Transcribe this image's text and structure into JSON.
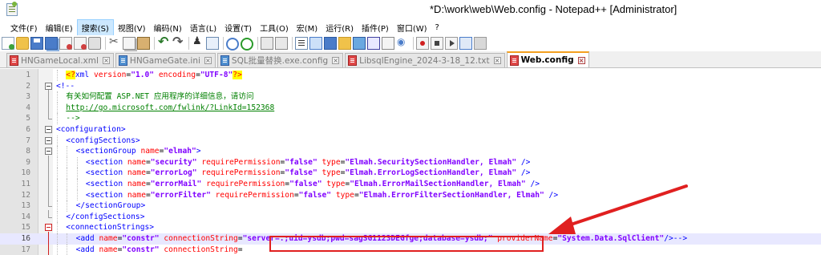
{
  "window": {
    "title": "*D:\\work\\web\\Web.config - Notepad++ [Administrator]"
  },
  "menu": [
    {
      "label": "文件(F)",
      "name": "menu-file"
    },
    {
      "label": "编辑(E)",
      "name": "menu-edit"
    },
    {
      "label": "搜索(S)",
      "name": "menu-search",
      "active": true
    },
    {
      "label": "视图(V)",
      "name": "menu-view"
    },
    {
      "label": "编码(N)",
      "name": "menu-encoding"
    },
    {
      "label": "语言(L)",
      "name": "menu-language"
    },
    {
      "label": "设置(T)",
      "name": "menu-settings"
    },
    {
      "label": "工具(O)",
      "name": "menu-tools"
    },
    {
      "label": "宏(M)",
      "name": "menu-macro"
    },
    {
      "label": "运行(R)",
      "name": "menu-run"
    },
    {
      "label": "插件(P)",
      "name": "menu-plugins"
    },
    {
      "label": "窗口(W)",
      "name": "menu-window"
    },
    {
      "label": "?",
      "name": "menu-help"
    }
  ],
  "toolbar": [
    "new-file-icon",
    "open-file-icon",
    "save-icon",
    "save-all-icon",
    "close-icon",
    "close-all-icon",
    "print-icon",
    "|",
    "cut-icon",
    "copy-icon",
    "paste-icon",
    "|",
    "undo-icon",
    "redo-icon",
    "|",
    "find-icon",
    "replace-icon",
    "|",
    "zoom-in-icon",
    "zoom-out-icon",
    "|",
    "sync-vertical-icon",
    "sync-horizontal-icon",
    "|",
    "word-wrap-icon",
    "show-all-chars-icon",
    "indent-guide-icon",
    "language-icon",
    "document-map-icon",
    "function-list-icon",
    "folder-workspace-icon",
    "monitoring-icon",
    "|",
    "record-macro-icon",
    "stop-record-icon",
    "playback-macro-icon",
    "run-macro-multiple-icon",
    "save-macro-icon"
  ],
  "tabs": [
    {
      "label": "HNGameLocal.xml",
      "color": "red",
      "active": false
    },
    {
      "label": "HNGameGate.ini",
      "color": "blue",
      "active": false
    },
    {
      "label": "SQL批量替换.exe.config",
      "color": "blue",
      "active": false
    },
    {
      "label": "LibsqlEngine_2024-3-18_12.txt",
      "color": "red",
      "active": false
    },
    {
      "label": "Web.config",
      "color": "red",
      "active": true
    }
  ],
  "editor": {
    "current_line": 16,
    "lines": [
      {
        "n": "1",
        "fold": "",
        "indent": 1,
        "segments": [
          [
            "pi",
            "<?"
          ],
          [
            "tag",
            "xml"
          ],
          [
            "attr",
            " version"
          ],
          [
            "txt",
            "="
          ],
          [
            "val",
            "\"1.0\""
          ],
          [
            "attr",
            " encoding"
          ],
          [
            "txt",
            "="
          ],
          [
            "val",
            "\"UTF-8\""
          ],
          [
            "pi",
            "?>"
          ]
        ]
      },
      {
        "n": "2",
        "fold": "box",
        "indent": 0,
        "segments": [
          [
            "tag",
            "<!--"
          ]
        ]
      },
      {
        "n": "3",
        "fold": "vline",
        "indent": 1,
        "segments": [
          [
            "cmt",
            "有关如何配置 ASP.NET 应用程序的详细信息，请访问"
          ]
        ]
      },
      {
        "n": "4",
        "fold": "vline",
        "indent": 1,
        "segments": [
          [
            "link",
            "http://go.microsoft.com/fwlink/?LinkId=152368"
          ]
        ]
      },
      {
        "n": "5",
        "fold": "end",
        "indent": 1,
        "segments": [
          [
            "cmt",
            "-->"
          ]
        ]
      },
      {
        "n": "6",
        "fold": "box",
        "indent": 0,
        "segments": [
          [
            "tag",
            "<configuration>"
          ]
        ]
      },
      {
        "n": "7",
        "fold": "box",
        "indent": 1,
        "segments": [
          [
            "tag",
            "<configSections>"
          ]
        ]
      },
      {
        "n": "8",
        "fold": "box",
        "indent": 2,
        "segments": [
          [
            "tag",
            "<sectionGroup"
          ],
          [
            "attr",
            " name"
          ],
          [
            "txt",
            "="
          ],
          [
            "val",
            "\"elmah\""
          ],
          [
            "tag",
            ">"
          ]
        ]
      },
      {
        "n": "9",
        "fold": "vline",
        "indent": 3,
        "segments": [
          [
            "tag",
            "<section"
          ],
          [
            "attr",
            " name"
          ],
          [
            "txt",
            "="
          ],
          [
            "val",
            "\"security\""
          ],
          [
            "attr",
            " requirePermission"
          ],
          [
            "txt",
            "="
          ],
          [
            "val",
            "\"false\""
          ],
          [
            "attr",
            " type"
          ],
          [
            "txt",
            "="
          ],
          [
            "val",
            "\"Elmah.SecuritySectionHandler, Elmah\""
          ],
          [
            "tag",
            " />"
          ]
        ]
      },
      {
        "n": "10",
        "fold": "vline",
        "indent": 3,
        "segments": [
          [
            "tag",
            "<section"
          ],
          [
            "attr",
            " name"
          ],
          [
            "txt",
            "="
          ],
          [
            "val",
            "\"errorLog\""
          ],
          [
            "attr",
            " requirePermission"
          ],
          [
            "txt",
            "="
          ],
          [
            "val",
            "\"false\""
          ],
          [
            "attr",
            " type"
          ],
          [
            "txt",
            "="
          ],
          [
            "val",
            "\"Elmah.ErrorLogSectionHandler, Elmah\""
          ],
          [
            "tag",
            " />"
          ]
        ]
      },
      {
        "n": "11",
        "fold": "vline",
        "indent": 3,
        "segments": [
          [
            "tag",
            "<section"
          ],
          [
            "attr",
            " name"
          ],
          [
            "txt",
            "="
          ],
          [
            "val",
            "\"errorMail\""
          ],
          [
            "attr",
            " requirePermission"
          ],
          [
            "txt",
            "="
          ],
          [
            "val",
            "\"false\""
          ],
          [
            "attr",
            " type"
          ],
          [
            "txt",
            "="
          ],
          [
            "val",
            "\"Elmah.ErrorMailSectionHandler, Elmah\""
          ],
          [
            "tag",
            " />"
          ]
        ]
      },
      {
        "n": "12",
        "fold": "vline",
        "indent": 3,
        "segments": [
          [
            "tag",
            "<section"
          ],
          [
            "attr",
            " name"
          ],
          [
            "txt",
            "="
          ],
          [
            "val",
            "\"errorFilter\""
          ],
          [
            "attr",
            " requirePermission"
          ],
          [
            "txt",
            "="
          ],
          [
            "val",
            "\"false\""
          ],
          [
            "attr",
            " type"
          ],
          [
            "txt",
            "="
          ],
          [
            "val",
            "\"Elmah.ErrorFilterSectionHandler, Elmah\""
          ],
          [
            "tag",
            " />"
          ]
        ]
      },
      {
        "n": "13",
        "fold": "end",
        "indent": 2,
        "segments": [
          [
            "tag",
            "</sectionGroup>"
          ]
        ]
      },
      {
        "n": "14",
        "fold": "end",
        "indent": 1,
        "segments": [
          [
            "tag",
            "</configSections>"
          ]
        ]
      },
      {
        "n": "15",
        "fold": "box-red",
        "indent": 1,
        "segments": [
          [
            "tag",
            "<connectionStrings>"
          ]
        ]
      },
      {
        "n": "16",
        "fold": "vline-red",
        "indent": 2,
        "segments": [
          [
            "tag",
            "<add"
          ],
          [
            "attr",
            " name"
          ],
          [
            "txt",
            "="
          ],
          [
            "val",
            "\"constr\""
          ],
          [
            "attr",
            " connectionString"
          ],
          [
            "txt",
            "="
          ],
          [
            "val",
            "\"server=.;uid=ysdb;pwd=sagSG1123DEGfge;database=ysdb;\""
          ],
          [
            "attr",
            " providerName"
          ],
          [
            "txt",
            "="
          ],
          [
            "val",
            "\"System.Data.SqlClient\""
          ],
          [
            "tag",
            "/>"
          ],
          [
            "tag",
            "-->"
          ]
        ]
      },
      {
        "n": "17",
        "fold": "vline-red",
        "indent": 2,
        "segments": [
          [
            "tag",
            "<add"
          ],
          [
            "attr",
            " name"
          ],
          [
            "txt",
            "="
          ],
          [
            "val",
            "\"constr\""
          ],
          [
            "attr",
            " connectionString"
          ],
          [
            "txt",
            "="
          ]
        ]
      }
    ]
  },
  "annotation": {
    "color": "#e02020",
    "highlighted_text": "server=.;uid=ysdb;pwd=sagSG1123DEGfge;database=ysdb;"
  }
}
